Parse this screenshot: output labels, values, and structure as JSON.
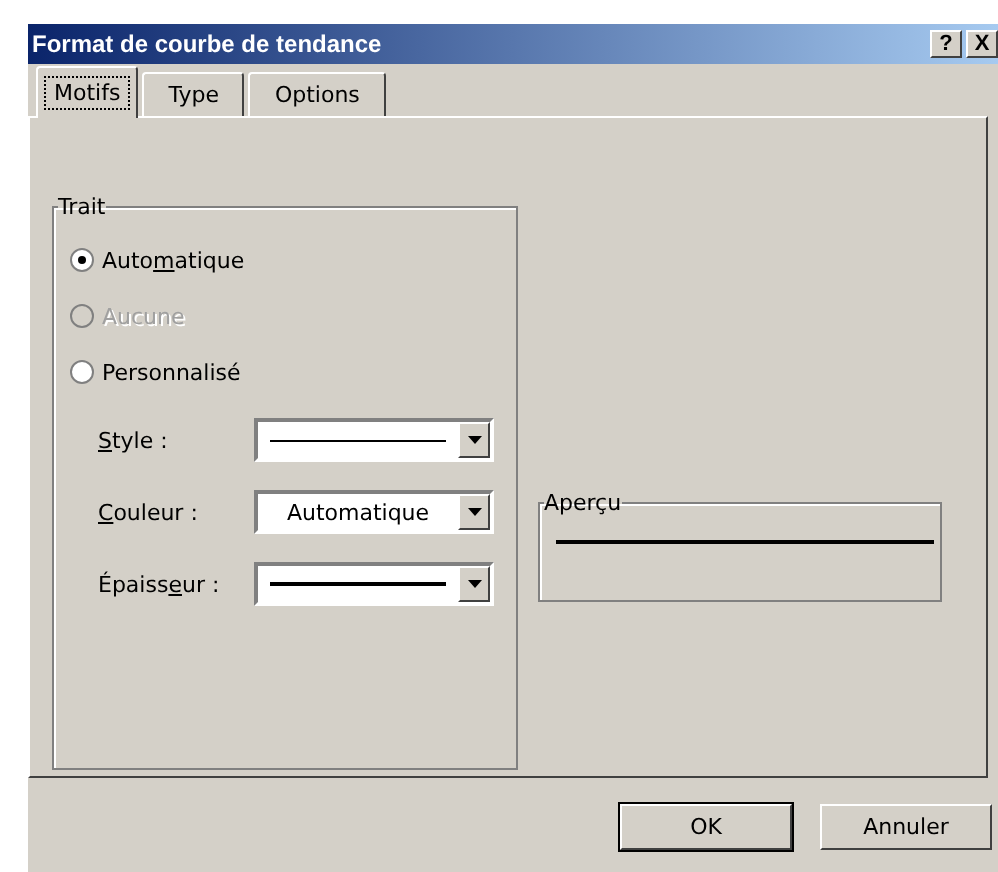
{
  "window": {
    "title": "Format de courbe de tendance",
    "help_button": "?",
    "close_button": "X"
  },
  "tabs": [
    {
      "label": "Motifs",
      "selected": true
    },
    {
      "label": "Type",
      "selected": false
    },
    {
      "label": "Options",
      "selected": false
    }
  ],
  "trait": {
    "legend": "Trait",
    "options": [
      {
        "before": "Auto",
        "mnemonic": "m",
        "after": "atique",
        "selected": true,
        "disabled": false
      },
      {
        "before": "Aucune",
        "selected": false,
        "disabled": true
      },
      {
        "before": "Personnalisé",
        "selected": false,
        "disabled": false
      }
    ],
    "fields": [
      {
        "mnemonic": "S",
        "after": "tyle :",
        "kind": "thin-line"
      },
      {
        "mnemonic": "C",
        "after": "ouleur :",
        "kind": "text",
        "value": "Automatique"
      },
      {
        "before": "Épaiss",
        "mnemonic": "e",
        "after": "ur :",
        "kind": "thick-line"
      }
    ]
  },
  "preview": {
    "legend": "Aperçu"
  },
  "buttons": [
    {
      "label": "OK",
      "default": true
    },
    {
      "label": "Annuler",
      "default": false
    }
  ]
}
